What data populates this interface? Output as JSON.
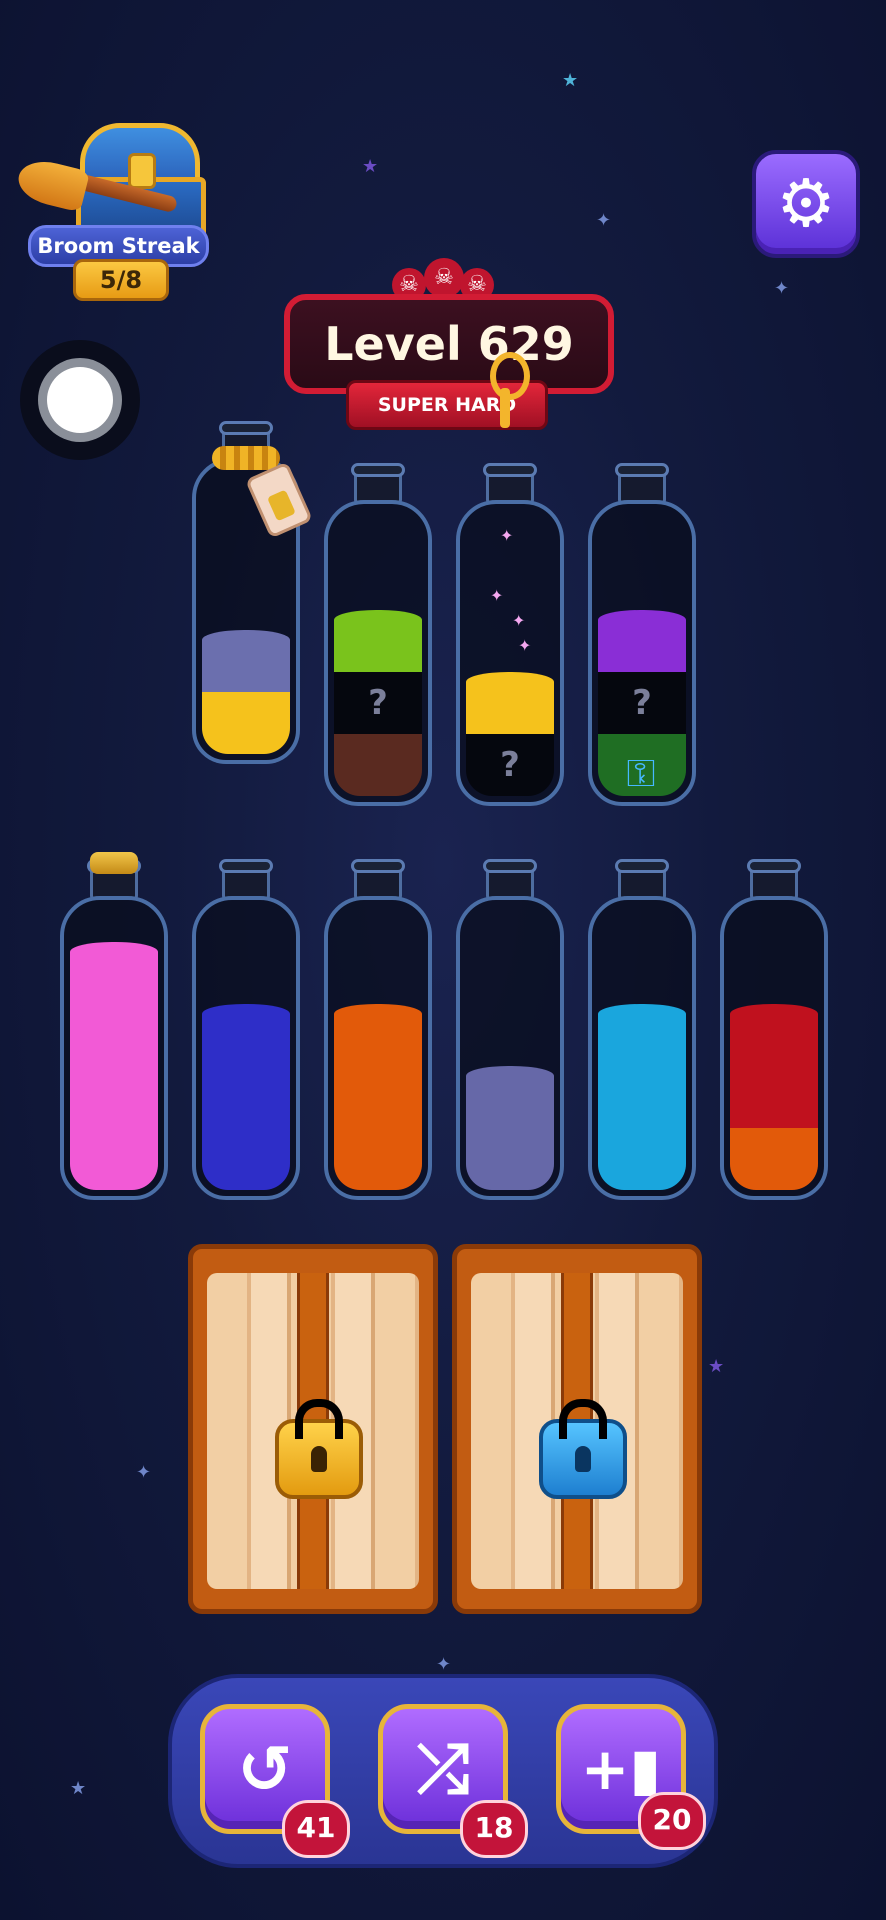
{
  "streak": {
    "label": "Broom Streak",
    "count": "5/8",
    "icon": "treasure-chest-broom-icon"
  },
  "settings": {
    "icon": "gear-icon",
    "glyph": "⚙"
  },
  "level": {
    "title": "Level 629",
    "difficulty": "SUPER HARD",
    "skulls": 3
  },
  "bottles_top": [
    {
      "name": "bottle-1",
      "layers": [
        "#6b6fae",
        "#f5c21c"
      ],
      "extras": "rope-tag"
    },
    {
      "name": "bottle-2",
      "layers": [
        "#7ac31c",
        "?",
        "#5a2a20"
      ]
    },
    {
      "name": "bottle-3",
      "layers": [
        "#f5c21c",
        "?"
      ],
      "extras": "sparkles"
    },
    {
      "name": "bottle-4",
      "layers": [
        "#8a2ed6",
        "?",
        "#1f6e23"
      ],
      "extras": "key"
    }
  ],
  "bottles_bottom": [
    {
      "name": "bottle-5",
      "layers": [
        "#f25ad6",
        "#f25ad6",
        "#f25ad6",
        "#f25ad6"
      ],
      "extras": "cork"
    },
    {
      "name": "bottle-6",
      "layers": [
        "#2e2ec8",
        "#2e2ec8",
        "#2e2ec8"
      ]
    },
    {
      "name": "bottle-7",
      "layers": [
        "#e25a0a",
        "#e25a0a",
        "#e25a0a"
      ]
    },
    {
      "name": "bottle-8",
      "layers": [
        "#6668a8",
        "#6668a8"
      ]
    },
    {
      "name": "bottle-9",
      "layers": [
        "#1aa6dd",
        "#1aa6dd",
        "#1aa6dd"
      ]
    },
    {
      "name": "bottle-10",
      "layers": [
        "#c0111e",
        "#c0111e",
        "#e25a0a"
      ]
    }
  ],
  "crates": [
    {
      "lock": "gold",
      "icon": "gold-padlock-icon"
    },
    {
      "lock": "blue",
      "icon": "blue-padlock-icon"
    }
  ],
  "tools": [
    {
      "name": "undo",
      "icon": "undo-icon",
      "glyph": "↺",
      "count": "41"
    },
    {
      "name": "shuffle",
      "icon": "shuffle-icon",
      "glyph": "⤮",
      "count": "18"
    },
    {
      "name": "add-bottle",
      "icon": "add-bottle-icon",
      "glyph": "+▮",
      "count": "20"
    }
  ],
  "colors": {
    "gold": "#f3b52c",
    "blue_lock": "#3aa6e8",
    "accent_purple": "#7a3ef0"
  }
}
